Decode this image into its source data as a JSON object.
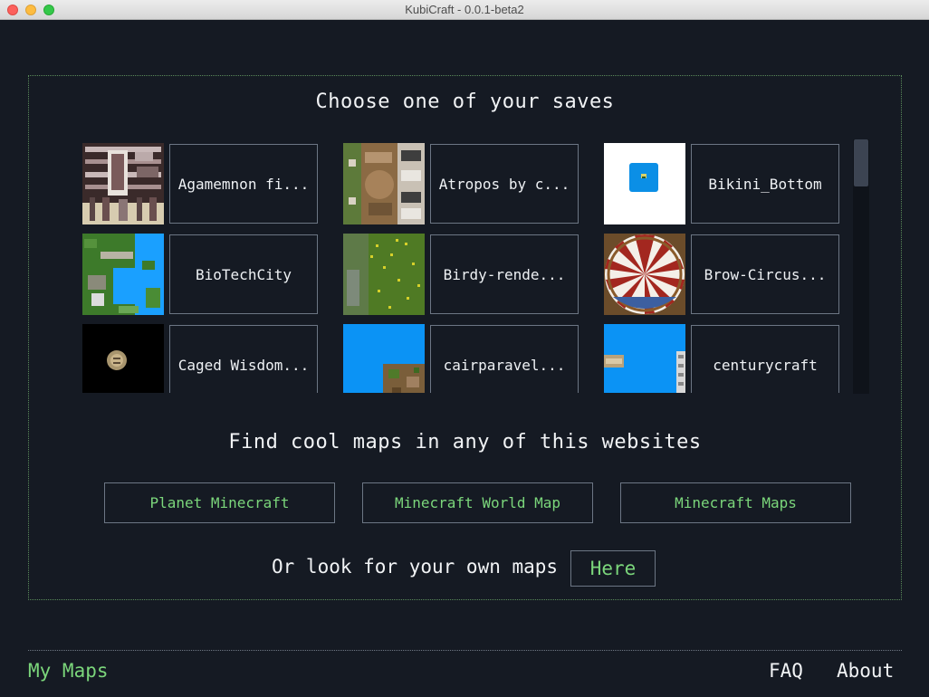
{
  "window": {
    "title": "KubiCraft - 0.0.1-beta2"
  },
  "saves": {
    "heading": "Choose one of your saves",
    "items": [
      {
        "name": "Agamemnon fi...",
        "thumb": "agamemnon-map-thumbnail"
      },
      {
        "name": "Atropos by c...",
        "thumb": "atropos-map-thumbnail"
      },
      {
        "name": "Bikini_Bottom",
        "thumb": "bikini-bottom-map-thumbnail"
      },
      {
        "name": "BioTechCity",
        "thumb": "biotechcity-map-thumbnail"
      },
      {
        "name": "Birdy-rende...",
        "thumb": "birdy-map-thumbnail"
      },
      {
        "name": "Brow-Circus...",
        "thumb": "brow-circus-map-thumbnail"
      },
      {
        "name": "Caged Wisdom...",
        "thumb": "caged-wisdom-map-thumbnail"
      },
      {
        "name": "cairparavel...",
        "thumb": "cairparavel-map-thumbnail"
      },
      {
        "name": "centurycraft",
        "thumb": "centurycraft-map-thumbnail"
      }
    ]
  },
  "websites": {
    "heading": "Find cool maps in any of this websites",
    "buttons": [
      "Planet Minecraft",
      "Minecraft World Map",
      "Minecraft Maps"
    ]
  },
  "own_maps": {
    "text": "Or look for your own maps",
    "button": "Here"
  },
  "footer": {
    "my_maps": "My Maps",
    "faq": "FAQ",
    "about": "About"
  },
  "colors": {
    "background": "#151a23",
    "accent_green": "#7bd67b",
    "border": "#6c7684",
    "text": "#f1f3f5"
  }
}
